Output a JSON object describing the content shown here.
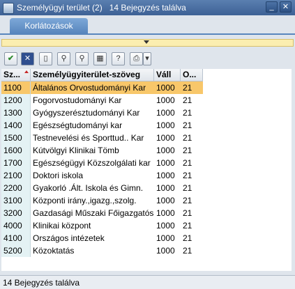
{
  "window": {
    "title": "Személyügyi terület (2)   14 Bejegyzés találva"
  },
  "tabs": [
    {
      "label": "Korlátozások"
    }
  ],
  "toolbar": {
    "buttons": [
      "check-icon",
      "close-icon",
      "new-icon",
      "find-icon",
      "find-next-icon",
      "settings-icon",
      "help-icon",
      "print-icon"
    ]
  },
  "table": {
    "columns": [
      "Sz...",
      "Személyügyiterület-szöveg",
      "Váll",
      "O..."
    ],
    "rows": [
      {
        "code": "1100",
        "text": "Általános Orvostudományi Kar",
        "vall": "1000",
        "o": "21",
        "selected": true
      },
      {
        "code": "1200",
        "text": "Fogorvostudományi Kar",
        "vall": "1000",
        "o": "21"
      },
      {
        "code": "1300",
        "text": "Gyógyszerésztudományi Kar",
        "vall": "1000",
        "o": "21"
      },
      {
        "code": "1400",
        "text": "Egészségtudományi kar",
        "vall": "1000",
        "o": "21"
      },
      {
        "code": "1500",
        "text": "Testnevelési és Sporttud.. Kar",
        "vall": "1000",
        "o": "21"
      },
      {
        "code": "1600",
        "text": "Kútvölgyi Klinikai Tömb",
        "vall": "1000",
        "o": "21"
      },
      {
        "code": "1700",
        "text": "Egészségügyi Közszolgálati kar",
        "vall": "1000",
        "o": "21"
      },
      {
        "code": "2100",
        "text": "Doktori iskola",
        "vall": "1000",
        "o": "21"
      },
      {
        "code": "2200",
        "text": "Gyakorló .Ált. Iskola és Gimn.",
        "vall": "1000",
        "o": "21"
      },
      {
        "code": "3100",
        "text": "Központi irány.,igazg.,szolg.",
        "vall": "1000",
        "o": "21"
      },
      {
        "code": "3200",
        "text": "Gazdasági Műszaki Főigazgatós.",
        "vall": "1000",
        "o": "21"
      },
      {
        "code": "4000",
        "text": "Klinikai központ",
        "vall": "1000",
        "o": "21"
      },
      {
        "code": "4100",
        "text": "Országos intézetek",
        "vall": "1000",
        "o": "21"
      },
      {
        "code": "5200",
        "text": "Közoktatás",
        "vall": "1000",
        "o": "21"
      }
    ]
  },
  "status": {
    "text": "14 Bejegyzés találva"
  }
}
